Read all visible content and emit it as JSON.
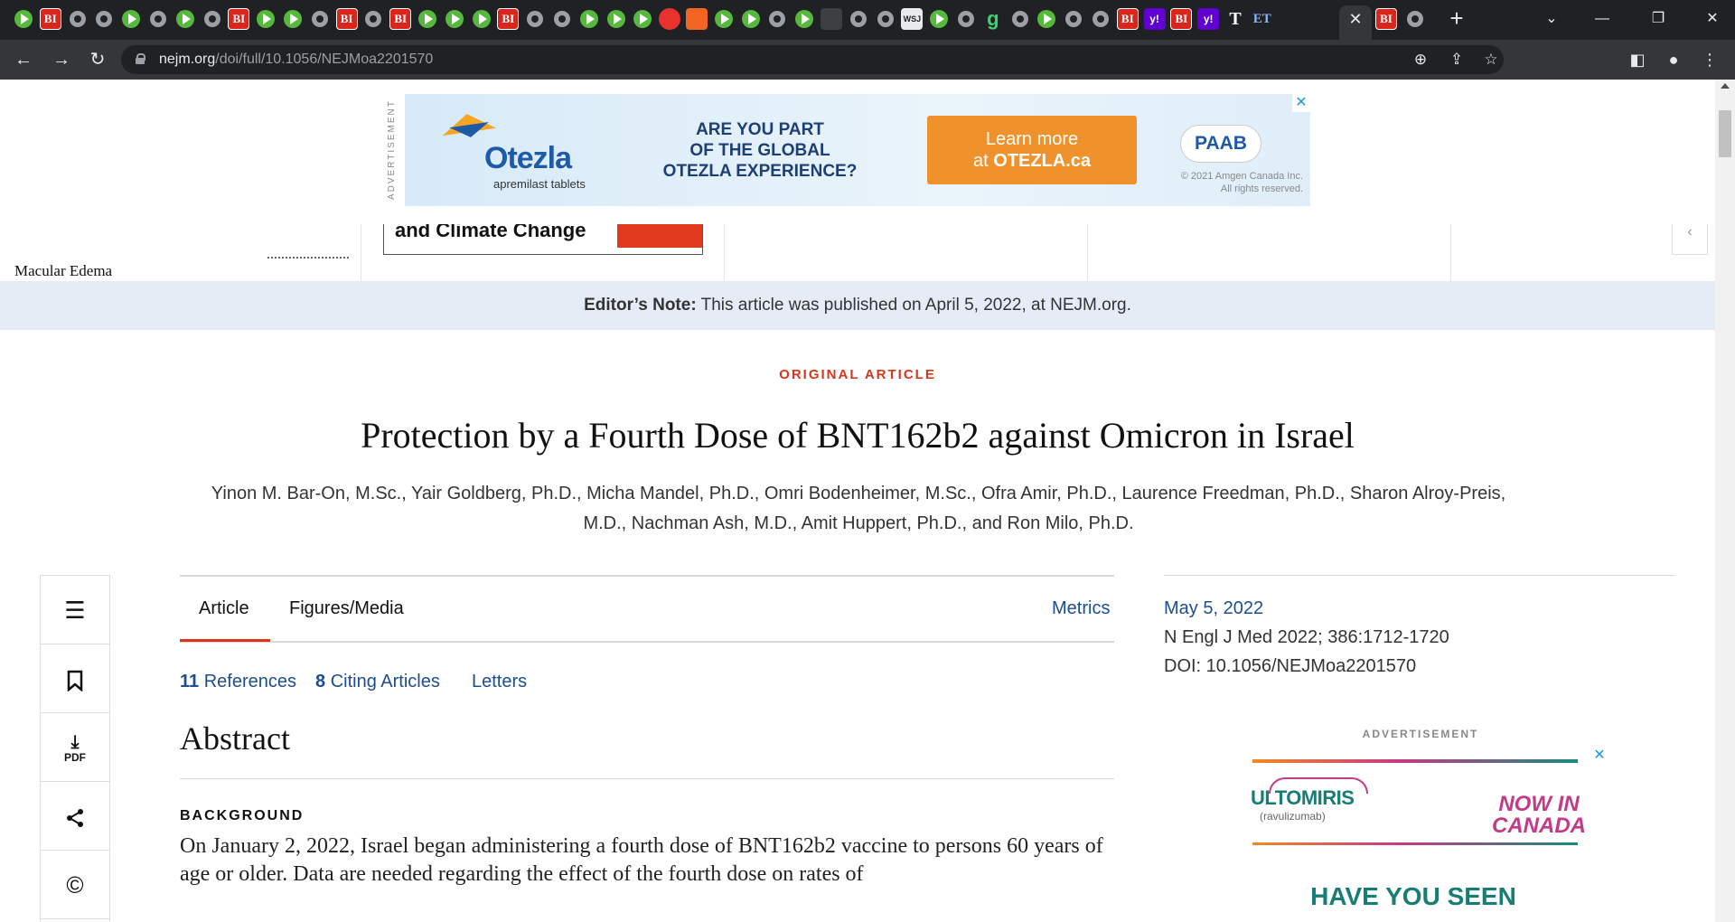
{
  "browser": {
    "tabs": [
      {
        "icon": "play-icon",
        "kind": "play"
      },
      {
        "icon": "bi-icon",
        "kind": "bi",
        "glyph": "BI"
      },
      {
        "icon": "globe-icon",
        "kind": "globe"
      },
      {
        "icon": "globe-icon",
        "kind": "globe"
      },
      {
        "icon": "play-icon",
        "kind": "play"
      },
      {
        "icon": "globe-icon",
        "kind": "globe"
      },
      {
        "icon": "play-icon",
        "kind": "play"
      },
      {
        "icon": "globe-icon",
        "kind": "globe"
      },
      {
        "icon": "bi-icon",
        "kind": "bi",
        "glyph": "BI"
      },
      {
        "icon": "play-icon",
        "kind": "play"
      },
      {
        "icon": "play-icon",
        "kind": "play"
      },
      {
        "icon": "globe-icon",
        "kind": "globe"
      },
      {
        "icon": "bi-icon",
        "kind": "bi",
        "glyph": "BI"
      },
      {
        "icon": "globe-icon",
        "kind": "globe"
      },
      {
        "icon": "bi-icon",
        "kind": "bi",
        "glyph": "BI"
      },
      {
        "icon": "play-icon",
        "kind": "play"
      },
      {
        "icon": "play-icon",
        "kind": "play"
      },
      {
        "icon": "play-icon",
        "kind": "play"
      },
      {
        "icon": "bi-icon",
        "kind": "bi",
        "glyph": "BI"
      },
      {
        "icon": "globe-icon",
        "kind": "globe"
      },
      {
        "icon": "globe-icon",
        "kind": "globe"
      },
      {
        "icon": "play-icon",
        "kind": "play"
      },
      {
        "icon": "play-icon",
        "kind": "play"
      },
      {
        "icon": "play-icon",
        "kind": "play"
      },
      {
        "icon": "red-pin-icon",
        "kind": "red"
      },
      {
        "icon": "bookmark-orange-icon",
        "kind": "orange"
      },
      {
        "icon": "play-icon",
        "kind": "play"
      },
      {
        "icon": "play-icon",
        "kind": "play"
      },
      {
        "icon": "globe-icon",
        "kind": "globe"
      },
      {
        "icon": "play-icon",
        "kind": "play"
      },
      {
        "icon": "dark-square-icon",
        "kind": "dark"
      },
      {
        "icon": "globe-icon",
        "kind": "globe"
      },
      {
        "icon": "globe-icon",
        "kind": "globe"
      },
      {
        "icon": "wsj-icon",
        "kind": "wsj",
        "glyph": "WSJ"
      },
      {
        "icon": "play-icon",
        "kind": "play"
      },
      {
        "icon": "globe-icon",
        "kind": "globe"
      },
      {
        "icon": "g-icon",
        "kind": "g",
        "glyph": "g"
      },
      {
        "icon": "globe-icon",
        "kind": "globe"
      },
      {
        "icon": "play-icon",
        "kind": "play"
      },
      {
        "icon": "globe-icon",
        "kind": "globe"
      },
      {
        "icon": "globe-icon",
        "kind": "globe"
      },
      {
        "icon": "bi-icon",
        "kind": "bi",
        "glyph": "BI"
      },
      {
        "icon": "yahoo-icon",
        "kind": "yahoo",
        "glyph": "y!"
      },
      {
        "icon": "bi-icon",
        "kind": "bi",
        "glyph": "BI"
      },
      {
        "icon": "yahoo-icon",
        "kind": "yahoo",
        "glyph": "y!"
      },
      {
        "icon": "nyt-icon",
        "kind": "nyt",
        "glyph": "T"
      },
      {
        "icon": "et-icon",
        "kind": "et",
        "glyph": "ET"
      }
    ],
    "after_tabs": [
      {
        "icon": "bi-icon",
        "kind": "bi",
        "glyph": "BI"
      },
      {
        "icon": "globe-icon",
        "kind": "globe"
      }
    ],
    "active_tab_close": "✕",
    "new_tab": "+",
    "window": {
      "dropdown": "⌄",
      "minimize": "—",
      "restore": "❐",
      "close": "✕"
    },
    "url_host": "nejm.org",
    "url_path": "/doi/full/10.1056/NEJMoa2201570"
  },
  "ad_top": {
    "label": "ADVERTISEMENT",
    "brand": "Otezla",
    "brand_sub": "apremilast tablets",
    "headline": "ARE YOU PART\nOF THE GLOBAL\nOTEZLA EXPERIENCE?",
    "cta_line1": "Learn more",
    "cta_line2_prefix": "at ",
    "cta_line2_bold": "OTEZLA.ca",
    "paab": "PAAB",
    "legal": "© 2021 Amgen Canada Inc.\nAll rights reserved.",
    "close": "✕"
  },
  "carousel": {
    "item1": "Macular Edema",
    "item2": "and Climate Change"
  },
  "editor_note": {
    "label": "Editor’s Note:",
    "text": " This article was published on April 5, 2022, at NEJM.org."
  },
  "article": {
    "type": "ORIGINAL ARTICLE",
    "title": "Protection by a Fourth Dose of BNT162b2 against Omicron in Israel",
    "authors": "Yinon M. Bar-On, M.Sc., Yair Goldberg, Ph.D., Micha Mandel, Ph.D., Omri Bodenheimer, M.Sc., Ofra Amir, Ph.D., Laurence Freedman, Ph.D., Sharon Alroy-Preis, M.D., Nachman Ash, M.D., Amit Huppert, Ph.D., and Ron Milo, Ph.D."
  },
  "rail": {
    "toc": "☰",
    "bookmark": "🔖",
    "pdf": "PDF",
    "share": "⋖",
    "copyright": "©"
  },
  "tabs": {
    "article": "Article",
    "figures": "Figures/Media",
    "metrics": "Metrics"
  },
  "sublinks": {
    "refs_count": "11",
    "refs_label": "References",
    "citing_count": "8",
    "citing_label": "Citing Articles",
    "letters": "Letters"
  },
  "abstract": {
    "heading": "Abstract",
    "section": "BACKGROUND",
    "text": "On January 2, 2022, Israel began administering a fourth dose of BNT162b2 vaccine to persons 60 years of age or older. Data are needed regarding the effect of the fourth dose on rates of"
  },
  "sidebar": {
    "date": "May 5, 2022",
    "citation": "N Engl J Med 2022; 386:1712-1720",
    "doi": "DOI: 10.1056/NEJMoa2201570",
    "ad_label": "ADVERTISEMENT",
    "ad_brand": "ULTOMIRIS",
    "ad_brand_sub": "(ravulizumab)",
    "ad_tagline": "NOW IN\nCANADA",
    "ad_headline": "HAVE YOU SEEN",
    "ad_close": "✕"
  }
}
